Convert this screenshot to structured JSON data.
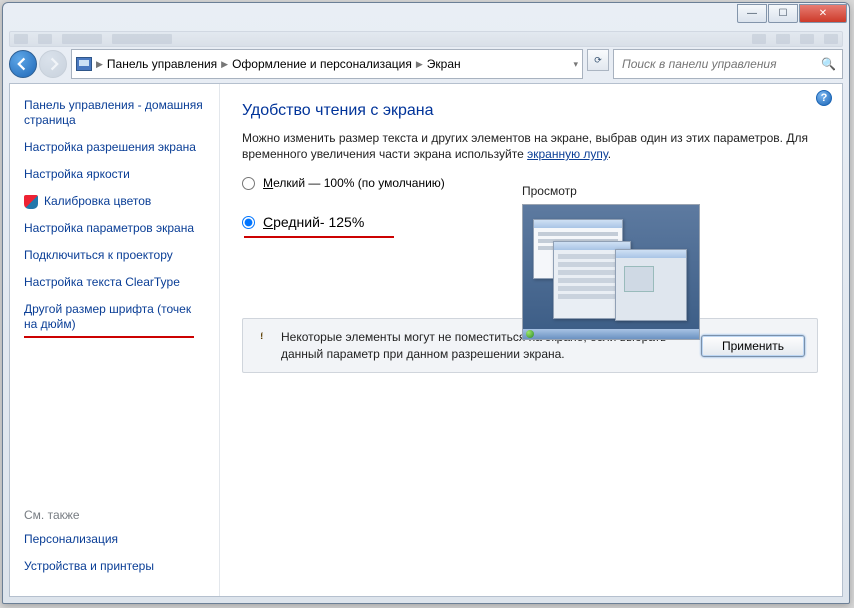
{
  "window": {
    "minimize": "—",
    "maximize": "☐",
    "close": "✕"
  },
  "breadcrumb": {
    "items": [
      "Панель управления",
      "Оформление и персонализация",
      "Экран"
    ]
  },
  "search": {
    "placeholder": "Поиск в панели управления"
  },
  "sidebar": {
    "home": "Панель управления - домашняя страница",
    "items": [
      "Настройка разрешения экрана",
      "Настройка яркости",
      "Калибровка цветов",
      "Настройка параметров экрана",
      "Подключиться к проектору",
      "Настройка текста ClearType",
      "Другой размер шрифта (точек на дюйм)"
    ],
    "see_also_label": "См. также",
    "see_also": [
      "Персонализация",
      "Устройства и принтеры"
    ]
  },
  "main": {
    "heading": "Удобство чтения с экрана",
    "desc1": "Можно изменить размер текста и других элементов на экране, выбрав один из этих параметров. Для временного увеличения части экрана используйте ",
    "desc_link": "экранную лупу",
    "desc_suffix": ".",
    "radio_small_u": "М",
    "radio_small_rest": "елкий — 100% (по умолчанию)",
    "radio_medium_u": "С",
    "radio_medium_rest": "редний- 125%",
    "preview_label": "Просмотр",
    "notice_text": "Некоторые элементы могут не поместиться на экране, если выбрать данный параметр при данном разрешении экрана.",
    "apply": "Применить"
  }
}
